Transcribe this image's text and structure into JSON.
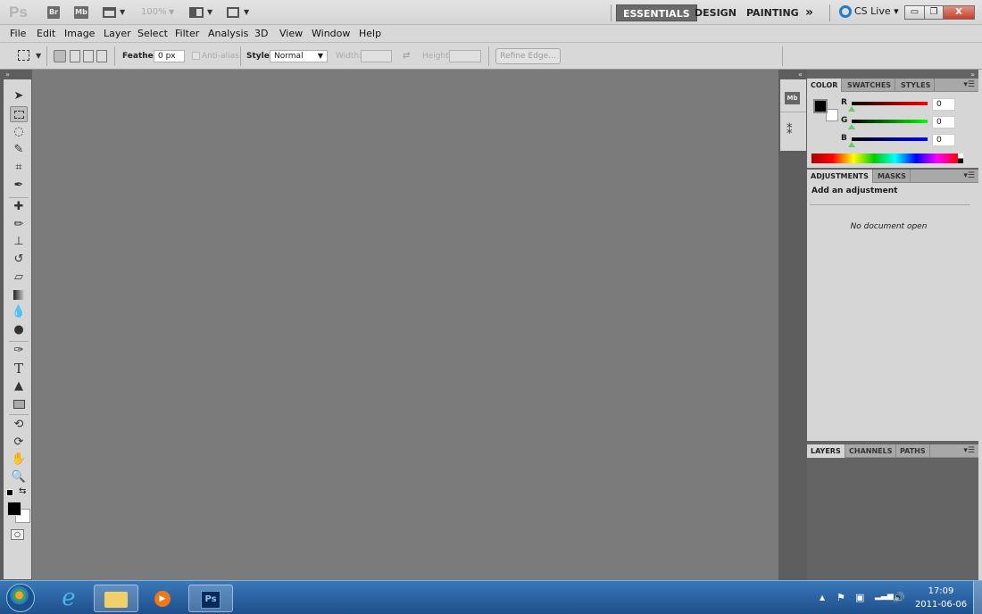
{
  "appbar": {
    "logo": "Ps",
    "bridge": "Br",
    "mini_bridge": "Mb",
    "zoom": "100%",
    "workspaces": [
      "ESSENTIALS",
      "DESIGN",
      "PAINTING"
    ],
    "more": "»",
    "cs_live": "CS Live ▾",
    "min": "▭",
    "restore": "❐",
    "close": "X"
  },
  "menu": [
    "File",
    "Edit",
    "Image",
    "Layer",
    "Select",
    "Filter",
    "Analysis",
    "3D",
    "View",
    "Window",
    "Help"
  ],
  "options": {
    "feather_label": "Feather:",
    "feather_value": "0 px",
    "antialias": "Anti-alias",
    "style_label": "Style:",
    "style_value": "Normal",
    "width_label": "Width:",
    "height_label": "Height:",
    "refine": "Refine Edge..."
  },
  "color_panel": {
    "tabs": [
      "COLOR",
      "SWATCHES",
      "STYLES"
    ],
    "channels": [
      {
        "label": "R",
        "value": "0"
      },
      {
        "label": "G",
        "value": "0"
      },
      {
        "label": "B",
        "value": "0"
      }
    ]
  },
  "adjustments_panel": {
    "tabs": [
      "ADJUSTMENTS",
      "MASKS"
    ],
    "heading": "Add an adjustment",
    "empty": "No document open"
  },
  "layers_panel": {
    "tabs": [
      "LAYERS",
      "CHANNELS",
      "PATHS"
    ]
  },
  "dock": {
    "mb": "Mb"
  },
  "taskbar": {
    "ps": "Ps",
    "time": "17:09",
    "date": "2011-06-06"
  }
}
